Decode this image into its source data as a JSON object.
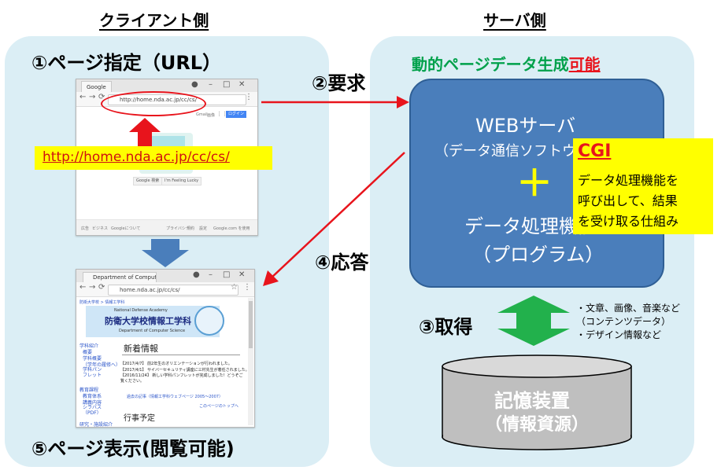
{
  "client": {
    "heading": "クライアント側",
    "step1": "①ページ指定（URL）",
    "step5": "⑤ページ表示(閲覧可能)",
    "url_label": "http://home.nda.ac.jp/cc/cs/",
    "browser1": {
      "tab": "Google",
      "address": "http://home.nda.ac.jp/cc/cs/",
      "top_links": [
        "Gmail",
        "画像"
      ],
      "signin": "ログイン",
      "btn_search": "Google 検索",
      "btn_lucky": "I'm Feeling Lucky",
      "footer_left": [
        "広告",
        "ビジネス",
        "Googleについて"
      ],
      "footer_right": [
        "プライバシー",
        "規約",
        "設定",
        "Google.com を使用"
      ]
    },
    "browser2": {
      "tab": "Department of Computer",
      "address": "home.nda.ac.jp/cc/cs/",
      "breadcrumb": "防衛大学校 > 情報工学科",
      "banner_en1": "National Defense Academy",
      "banner_jp": "防衛大学校情報工学科",
      "banner_en2": "Department of Computer Science",
      "sidebar": [
        "学科紹介",
        "概要",
        "学科概要",
        "（学年の履修へ）",
        "学科パンフレット",
        "教育課程",
        "教育体系",
        "講義内容",
        "シラバス（PDF）",
        "研究・施設紹介"
      ],
      "news_title": "新着情報",
      "news": [
        "【2017/4/7】 前2年生のオリエンテーションが行われました。",
        "【2017/4/1】 サイバーセキュリティ講座に三村先生が着任されました。",
        "【2016/11/24】 新しい学科パンフレットが完成しました！どうぞご覧ください。",
        "過去の記事（情報工学科ウェブページ 2005～2007）",
        "このページのトップへ"
      ],
      "events_title": "行事予定"
    }
  },
  "server": {
    "heading": "サーバ側",
    "dynamic_text": "動的ページデータ生成",
    "dynamic_emph": "可能",
    "web_title": "WEBサーバ",
    "web_sub": "（データ通信ソフトウェア）",
    "plus": "＋",
    "proc_title": "データ処理機能",
    "proc_sub": "（プログラム）",
    "storage_title": "記憶装置",
    "storage_sub": "（情報資源）"
  },
  "cgi": {
    "title": "CGI",
    "lines": [
      "データ処理機能を",
      "呼び出して、結果",
      "を受け取る仕組み"
    ]
  },
  "steps": {
    "request": "②要求",
    "response": "④応答",
    "acquire": "③取得"
  },
  "acquire_notes": [
    "・文章、画像、音楽など",
    "（コンテンツデータ）",
    "・デザイン情報など"
  ],
  "colors": {
    "panel": "#dbeef5",
    "server": "#4a7ebb",
    "arrow_red": "#e8141c",
    "arrow_green": "#22b14c",
    "arrow_blue": "#4a7ebb",
    "cgi_bg": "#ffff00",
    "cgi_title": "#e8141c",
    "dynamic_green": "#00a14b"
  }
}
